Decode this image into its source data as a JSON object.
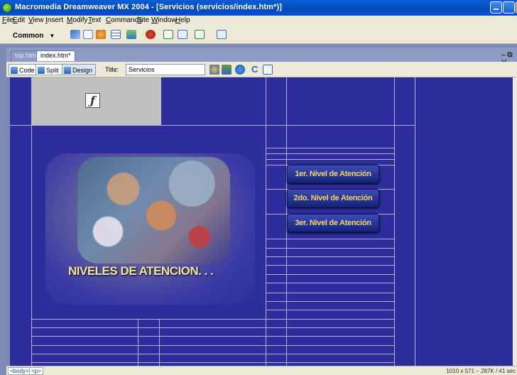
{
  "window": {
    "title": "Macromedia Dreamweaver MX 2004 - [Servicios (servicios/index.htm*)]"
  },
  "menu": {
    "items": [
      "File",
      "Edit",
      "View",
      "Insert",
      "Modify",
      "Text",
      "Commands",
      "Site",
      "Window",
      "Help"
    ]
  },
  "insert_bar": {
    "category": "Common",
    "icons": [
      "hyperlink-icon",
      "email-link-icon",
      "named-anchor-icon",
      "table-icon",
      "image-icon",
      "media-icon",
      "date-icon",
      "comment-icon",
      "templates-icon",
      "tag-chooser-icon"
    ]
  },
  "document": {
    "tabs": [
      "top.htm",
      "index.htm*"
    ],
    "view_buttons": [
      "Code",
      "Split",
      "Design"
    ],
    "title_label": "Title:",
    "title_value": "Servicios"
  },
  "page": {
    "banner_text": "NIVELES DE ATENCION. . .",
    "buttons": [
      "1er. Nivel de Atención",
      "2do. Nivel de Atención",
      "3er. Nivel de Atención"
    ]
  },
  "statusbar": {
    "tags": [
      "<body>",
      "<p>"
    ],
    "info": "1010 x 571 − 287K / 41 sec"
  },
  "colors": {
    "canvas_bg": "#2d2d9d",
    "button_text": "#f7d36a",
    "banner_text": "#f2e6a2"
  }
}
